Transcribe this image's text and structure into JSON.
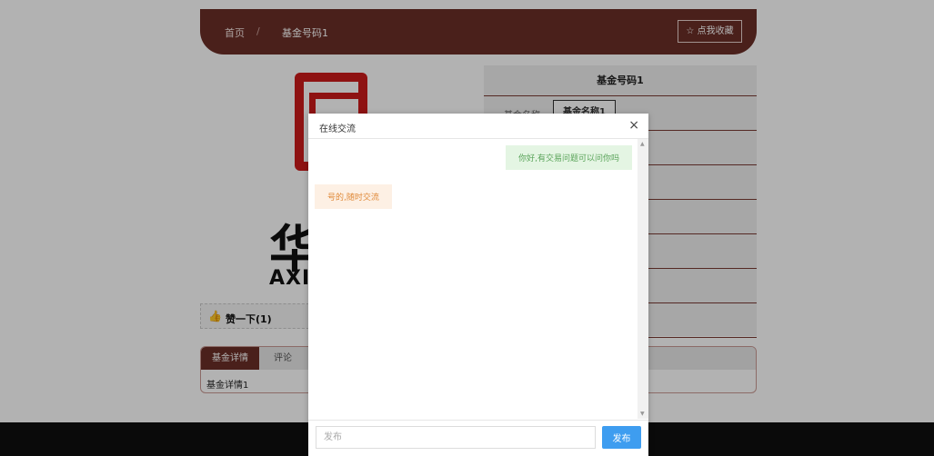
{
  "breadcrumb": {
    "home": "首页",
    "separator": "/",
    "current": "基金号码1"
  },
  "favorite_button": "☆ 点我收藏",
  "logo": {
    "char": "华夏",
    "text": "AXIA"
  },
  "info": {
    "title": "基金号码1",
    "rows": [
      {
        "label": "基金名称:",
        "value": "基金名称1"
      }
    ]
  },
  "like": {
    "icon": "thumbs-up-icon",
    "label": "赞一下(1)"
  },
  "tabs": {
    "items": [
      "基金详情",
      "评论"
    ],
    "content": "基金详情1"
  },
  "chat": {
    "title": "在线交流",
    "close": "×",
    "messages": [
      {
        "side": "right",
        "text": "你好,有交易问题可以问你吗"
      },
      {
        "side": "left",
        "text": "号的,随时交流"
      }
    ],
    "input_placeholder": "发布",
    "send_label": "发布"
  },
  "colors": {
    "brand": "#6b2f28",
    "accent": "#3e9df0",
    "seal": "#cc1b1b"
  }
}
